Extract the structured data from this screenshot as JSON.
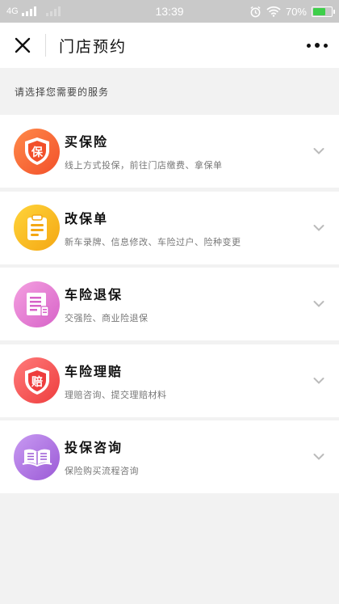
{
  "status_bar": {
    "network": "4G",
    "time": "13:39",
    "battery_percent": "70%",
    "battery_level": 0.7
  },
  "nav": {
    "title": "门店预约"
  },
  "subtitle": "请选择您需要的服务",
  "services": [
    {
      "title": "买保险",
      "desc": "线上方式投保，前往门店缴费、拿保单",
      "icon": "shield-bao-icon",
      "glyph": "保",
      "color_light": "#ff8a4a",
      "color_dark": "#f2502a"
    },
    {
      "title": "改保单",
      "desc": "新车录牌、信息修改、车险过户、险种变更",
      "icon": "document-edit-icon",
      "color_light": "#ffd43a",
      "color_dark": "#f4a713"
    },
    {
      "title": "车险退保",
      "desc": "交强险、商业险退保",
      "icon": "refund-document-icon",
      "color_light": "#f4a0e0",
      "color_dark": "#d763c8"
    },
    {
      "title": "车险理赔",
      "desc": "理赔咨询、提交理赔材料",
      "icon": "shield-pei-icon",
      "glyph": "赔",
      "color_light": "#ff7b7b",
      "color_dark": "#ee3d3d"
    },
    {
      "title": "投保咨询",
      "desc": "保险购买流程咨询",
      "icon": "open-book-icon",
      "color_light": "#c89af2",
      "color_dark": "#9b5ad6"
    }
  ]
}
